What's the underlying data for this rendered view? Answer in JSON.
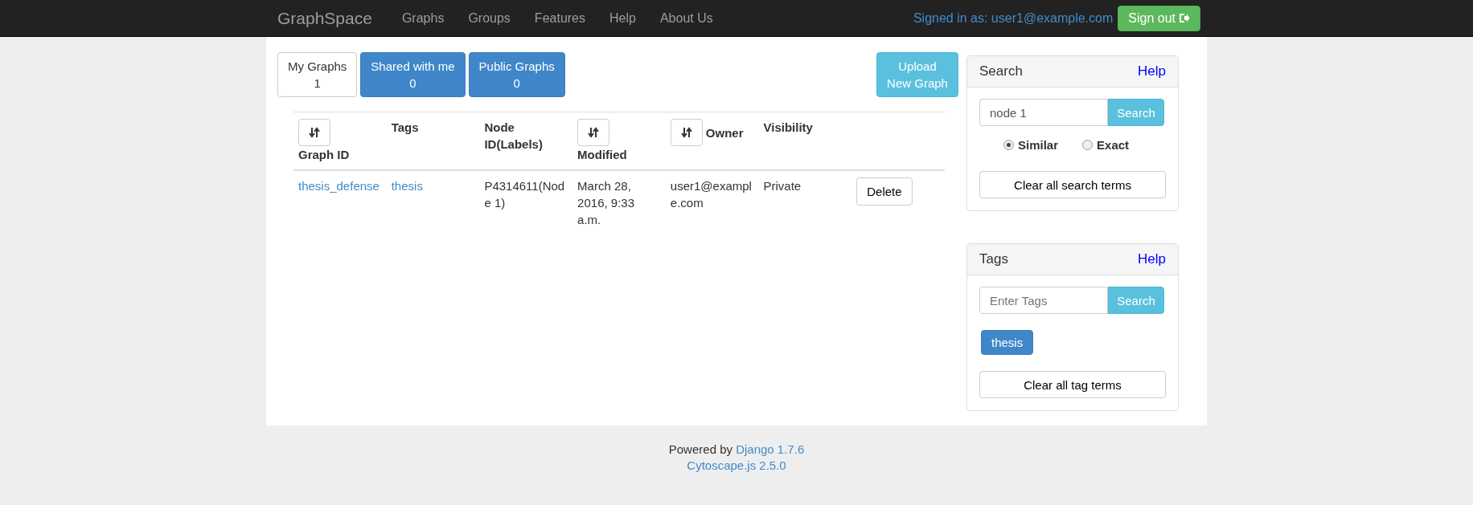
{
  "navbar": {
    "brand": "GraphSpace",
    "links": [
      "Graphs",
      "Groups",
      "Features",
      "Help",
      "About Us"
    ],
    "signed_in": "Signed in as: user1@example.com",
    "sign_out": "Sign out"
  },
  "tabs": [
    {
      "label": "My Graphs",
      "count": "1",
      "selected": true
    },
    {
      "label": "Shared with me",
      "count": "0",
      "selected": false
    },
    {
      "label": "Public Graphs",
      "count": "0",
      "selected": false
    }
  ],
  "upload_button": "Upload New Graph",
  "table": {
    "columns": [
      {
        "label": "Graph ID",
        "sortable": true
      },
      {
        "label": "Tags",
        "sortable": false
      },
      {
        "label": "Node ID(Labels)",
        "sortable": false
      },
      {
        "label": "Modified",
        "sortable": true
      },
      {
        "label": "Owner",
        "sortable": true
      },
      {
        "label": "Visibility",
        "sortable": false
      }
    ],
    "rows": [
      {
        "graph_id": "thesis_defense",
        "tags": "thesis",
        "node_id": "P4314611(Node 1)",
        "modified": "March 28, 2016, 9:33 a.m.",
        "owner": "user1@example.com",
        "visibility": "Private",
        "action": "Delete"
      }
    ]
  },
  "search_panel": {
    "title": "Search",
    "help": "Help",
    "value": "node 1",
    "button": "Search",
    "options": [
      {
        "label": "Similar",
        "selected": true
      },
      {
        "label": "Exact",
        "selected": false
      }
    ],
    "clear": "Clear all search terms"
  },
  "tags_panel": {
    "title": "Tags",
    "help": "Help",
    "placeholder": "Enter Tags",
    "button": "Search",
    "tags": [
      "thesis"
    ],
    "clear": "Clear all tag terms"
  },
  "footer": {
    "powered_by": "Powered by",
    "django": "Django 1.7.6",
    "cytoscape": "Cytoscape.js 2.5.0"
  }
}
